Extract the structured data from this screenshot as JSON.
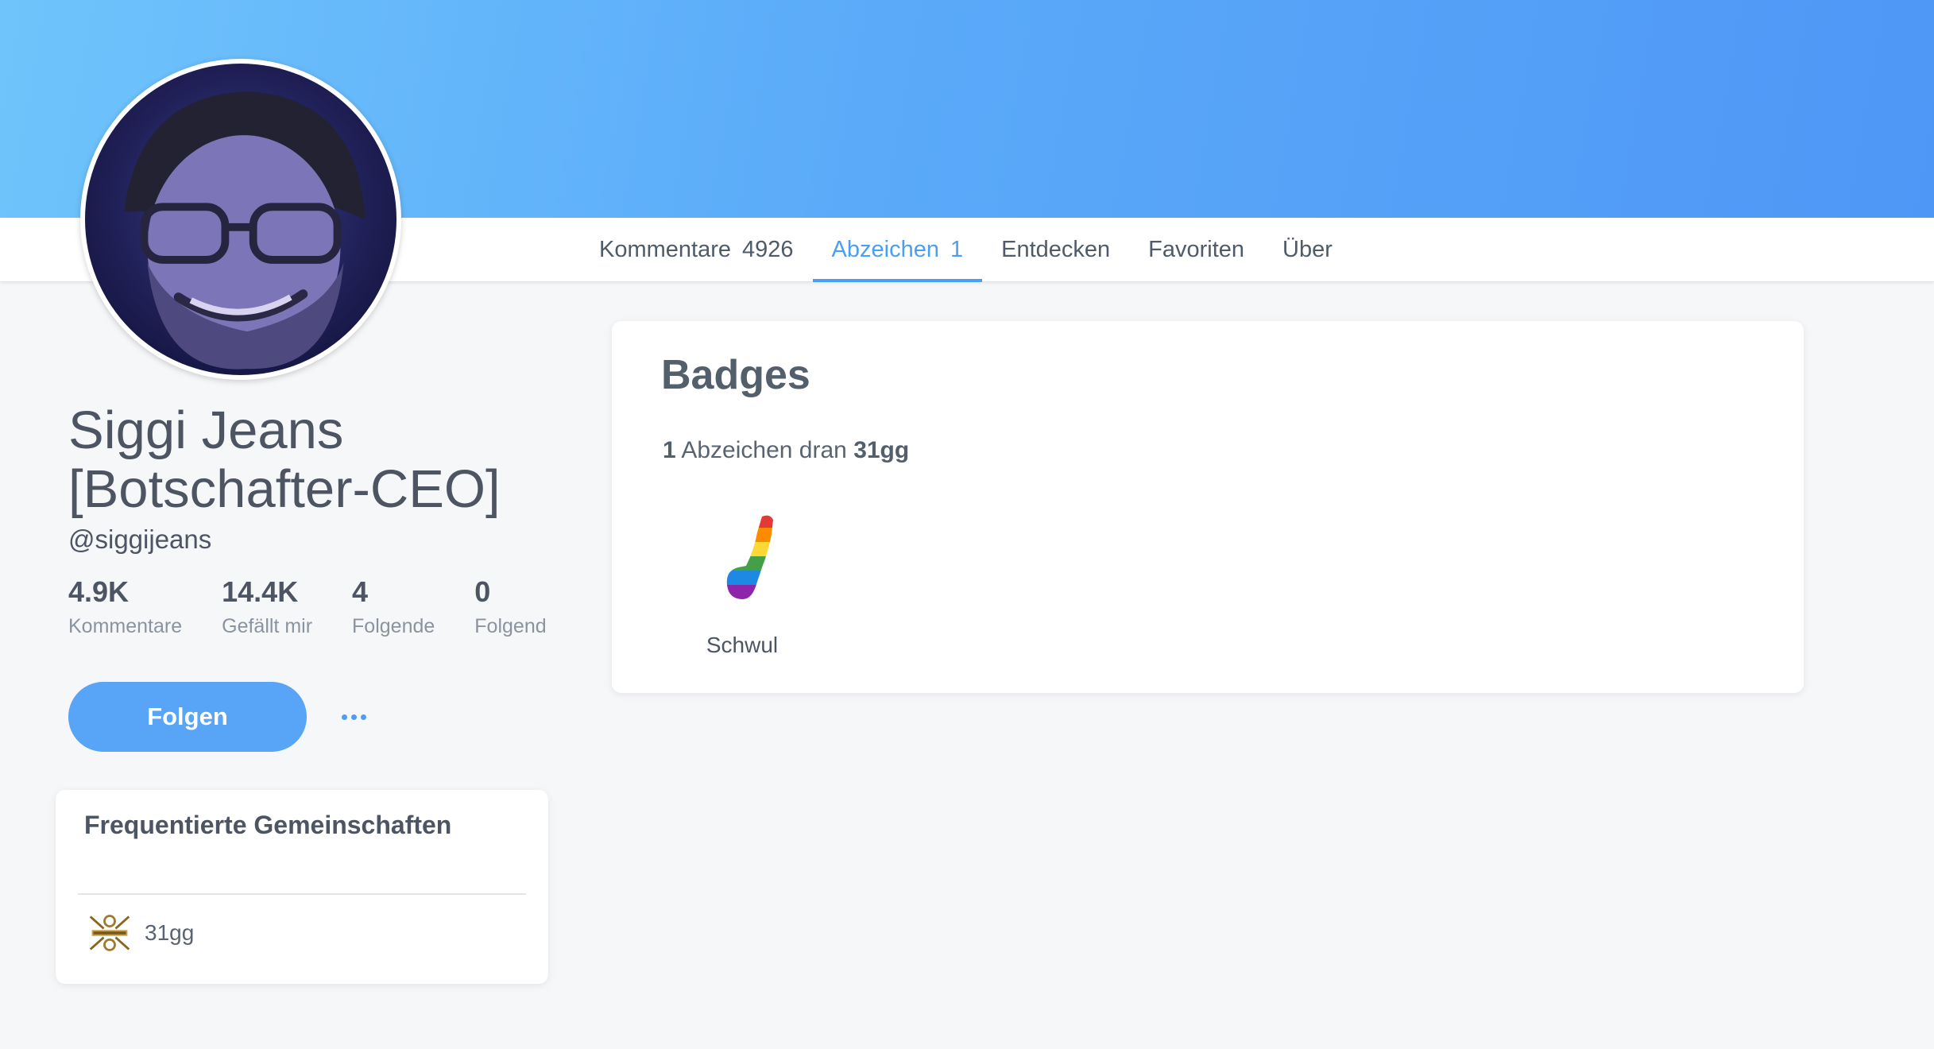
{
  "tabs": [
    {
      "label": "Kommentare",
      "count": "4926"
    },
    {
      "label": "Abzeichen",
      "count": "1"
    },
    {
      "label": "Entdecken"
    },
    {
      "label": "Favoriten"
    },
    {
      "label": "Über"
    }
  ],
  "profile": {
    "name": "Siggi Jeans [Botschafter-CEO]",
    "handle": "@siggijeans",
    "stats": [
      {
        "value": "4.9K",
        "label": "Kommentare"
      },
      {
        "value": "14.4K",
        "label": "Gefällt mir"
      },
      {
        "value": "4",
        "label": "Folgende"
      },
      {
        "value": "0",
        "label": "Folgend"
      }
    ],
    "follow_label": "Folgen"
  },
  "communities": {
    "title": "Frequentierte Gemeinschaften",
    "items": [
      {
        "name": "31gg",
        "icon": "community-logo-icon"
      }
    ]
  },
  "badges": {
    "title": "Badges",
    "count": "1",
    "text_mid": " Abzeichen dran ",
    "community": "31gg",
    "items": [
      {
        "name": "Schwul",
        "icon": "rainbow-badge-icon"
      }
    ]
  },
  "colors": {
    "accent": "#4a9ff5",
    "button": "#58a4f7",
    "banner_start": "#6fc4fb",
    "banner_end": "#4f97f6",
    "background": "#f6f7f9"
  }
}
